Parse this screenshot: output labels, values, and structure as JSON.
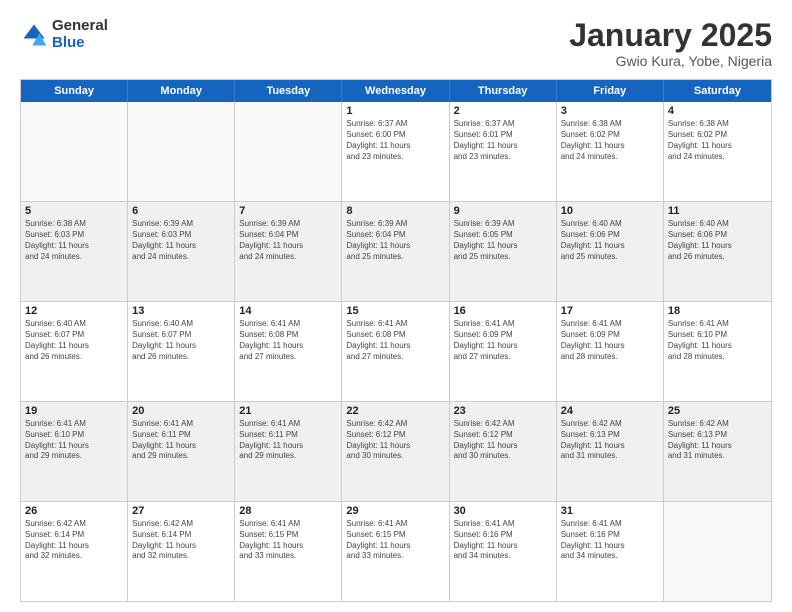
{
  "logo": {
    "general": "General",
    "blue": "Blue"
  },
  "title": "January 2025",
  "subtitle": "Gwio Kura, Yobe, Nigeria",
  "days": [
    "Sunday",
    "Monday",
    "Tuesday",
    "Wednesday",
    "Thursday",
    "Friday",
    "Saturday"
  ],
  "rows": [
    [
      {
        "day": "",
        "info": "",
        "empty": true
      },
      {
        "day": "",
        "info": "",
        "empty": true
      },
      {
        "day": "",
        "info": "",
        "empty": true
      },
      {
        "day": "1",
        "info": "Sunrise: 6:37 AM\nSunset: 6:00 PM\nDaylight: 11 hours\nand 23 minutes."
      },
      {
        "day": "2",
        "info": "Sunrise: 6:37 AM\nSunset: 6:01 PM\nDaylight: 11 hours\nand 23 minutes."
      },
      {
        "day": "3",
        "info": "Sunrise: 6:38 AM\nSunset: 6:02 PM\nDaylight: 11 hours\nand 24 minutes."
      },
      {
        "day": "4",
        "info": "Sunrise: 6:38 AM\nSunset: 6:02 PM\nDaylight: 11 hours\nand 24 minutes."
      }
    ],
    [
      {
        "day": "5",
        "info": "Sunrise: 6:38 AM\nSunset: 6:03 PM\nDaylight: 11 hours\nand 24 minutes."
      },
      {
        "day": "6",
        "info": "Sunrise: 6:39 AM\nSunset: 6:03 PM\nDaylight: 11 hours\nand 24 minutes."
      },
      {
        "day": "7",
        "info": "Sunrise: 6:39 AM\nSunset: 6:04 PM\nDaylight: 11 hours\nand 24 minutes."
      },
      {
        "day": "8",
        "info": "Sunrise: 6:39 AM\nSunset: 6:04 PM\nDaylight: 11 hours\nand 25 minutes."
      },
      {
        "day": "9",
        "info": "Sunrise: 6:39 AM\nSunset: 6:05 PM\nDaylight: 11 hours\nand 25 minutes."
      },
      {
        "day": "10",
        "info": "Sunrise: 6:40 AM\nSunset: 6:06 PM\nDaylight: 11 hours\nand 25 minutes."
      },
      {
        "day": "11",
        "info": "Sunrise: 6:40 AM\nSunset: 6:06 PM\nDaylight: 11 hours\nand 26 minutes."
      }
    ],
    [
      {
        "day": "12",
        "info": "Sunrise: 6:40 AM\nSunset: 6:07 PM\nDaylight: 11 hours\nand 26 minutes."
      },
      {
        "day": "13",
        "info": "Sunrise: 6:40 AM\nSunset: 6:07 PM\nDaylight: 11 hours\nand 26 minutes."
      },
      {
        "day": "14",
        "info": "Sunrise: 6:41 AM\nSunset: 6:08 PM\nDaylight: 11 hours\nand 27 minutes."
      },
      {
        "day": "15",
        "info": "Sunrise: 6:41 AM\nSunset: 6:08 PM\nDaylight: 11 hours\nand 27 minutes."
      },
      {
        "day": "16",
        "info": "Sunrise: 6:41 AM\nSunset: 6:09 PM\nDaylight: 11 hours\nand 27 minutes."
      },
      {
        "day": "17",
        "info": "Sunrise: 6:41 AM\nSunset: 6:09 PM\nDaylight: 11 hours\nand 28 minutes."
      },
      {
        "day": "18",
        "info": "Sunrise: 6:41 AM\nSunset: 6:10 PM\nDaylight: 11 hours\nand 28 minutes."
      }
    ],
    [
      {
        "day": "19",
        "info": "Sunrise: 6:41 AM\nSunset: 6:10 PM\nDaylight: 11 hours\nand 29 minutes."
      },
      {
        "day": "20",
        "info": "Sunrise: 6:41 AM\nSunset: 6:11 PM\nDaylight: 11 hours\nand 29 minutes."
      },
      {
        "day": "21",
        "info": "Sunrise: 6:41 AM\nSunset: 6:11 PM\nDaylight: 11 hours\nand 29 minutes."
      },
      {
        "day": "22",
        "info": "Sunrise: 6:42 AM\nSunset: 6:12 PM\nDaylight: 11 hours\nand 30 minutes."
      },
      {
        "day": "23",
        "info": "Sunrise: 6:42 AM\nSunset: 6:12 PM\nDaylight: 11 hours\nand 30 minutes."
      },
      {
        "day": "24",
        "info": "Sunrise: 6:42 AM\nSunset: 6:13 PM\nDaylight: 11 hours\nand 31 minutes."
      },
      {
        "day": "25",
        "info": "Sunrise: 6:42 AM\nSunset: 6:13 PM\nDaylight: 11 hours\nand 31 minutes."
      }
    ],
    [
      {
        "day": "26",
        "info": "Sunrise: 6:42 AM\nSunset: 6:14 PM\nDaylight: 11 hours\nand 32 minutes."
      },
      {
        "day": "27",
        "info": "Sunrise: 6:42 AM\nSunset: 6:14 PM\nDaylight: 11 hours\nand 32 minutes."
      },
      {
        "day": "28",
        "info": "Sunrise: 6:41 AM\nSunset: 6:15 PM\nDaylight: 11 hours\nand 33 minutes."
      },
      {
        "day": "29",
        "info": "Sunrise: 6:41 AM\nSunset: 6:15 PM\nDaylight: 11 hours\nand 33 minutes."
      },
      {
        "day": "30",
        "info": "Sunrise: 6:41 AM\nSunset: 6:16 PM\nDaylight: 11 hours\nand 34 minutes."
      },
      {
        "day": "31",
        "info": "Sunrise: 6:41 AM\nSunset: 6:16 PM\nDaylight: 11 hours\nand 34 minutes."
      },
      {
        "day": "",
        "info": "",
        "empty": true
      }
    ]
  ]
}
